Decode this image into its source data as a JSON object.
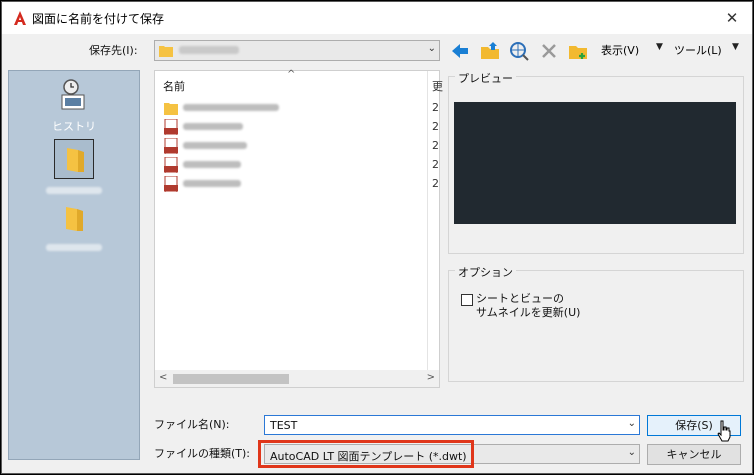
{
  "window": {
    "title": "図面に名前を付けて保存",
    "close_glyph": "✕"
  },
  "toolbar": {
    "save_in_label": "保存先(I):",
    "view_menu": "表示(V)",
    "tools_menu": "ツール(L)",
    "dropdown_glyph": "▼"
  },
  "places": [
    {
      "label": "ヒストリ",
      "icon": "history-icon"
    },
    {
      "label": "",
      "icon": "folder-icon",
      "selected": true
    },
    {
      "label": "",
      "icon": "folder-icon"
    }
  ],
  "file_list": {
    "header_name": "名前",
    "header_date": "更",
    "rows": [
      {
        "type": "folder",
        "date": "2"
      },
      {
        "type": "dwt",
        "date": "2"
      },
      {
        "type": "dwt",
        "date": "2"
      },
      {
        "type": "dwt",
        "date": "2"
      },
      {
        "type": "dwt",
        "date": "2"
      }
    ]
  },
  "preview": {
    "title": "プレビュー"
  },
  "options": {
    "title": "オプション",
    "thumbnail_label_line1": "シートとビューの",
    "thumbnail_label_line2": "サムネイルを更新(U)",
    "thumbnail_checked": false
  },
  "form": {
    "filename_label": "ファイル名(N):",
    "filename_value": "TEST",
    "filetype_label": "ファイルの種類(T):",
    "filetype_value": "AutoCAD LT 図面テンプレート (*.dwt)",
    "save_button": "保存(S)",
    "cancel_button": "キャンセル"
  },
  "colors": {
    "highlight": "#e0361a",
    "accent": "#0078d7",
    "preview_bg": "#212930",
    "places_bg": "#b7c8d8"
  }
}
